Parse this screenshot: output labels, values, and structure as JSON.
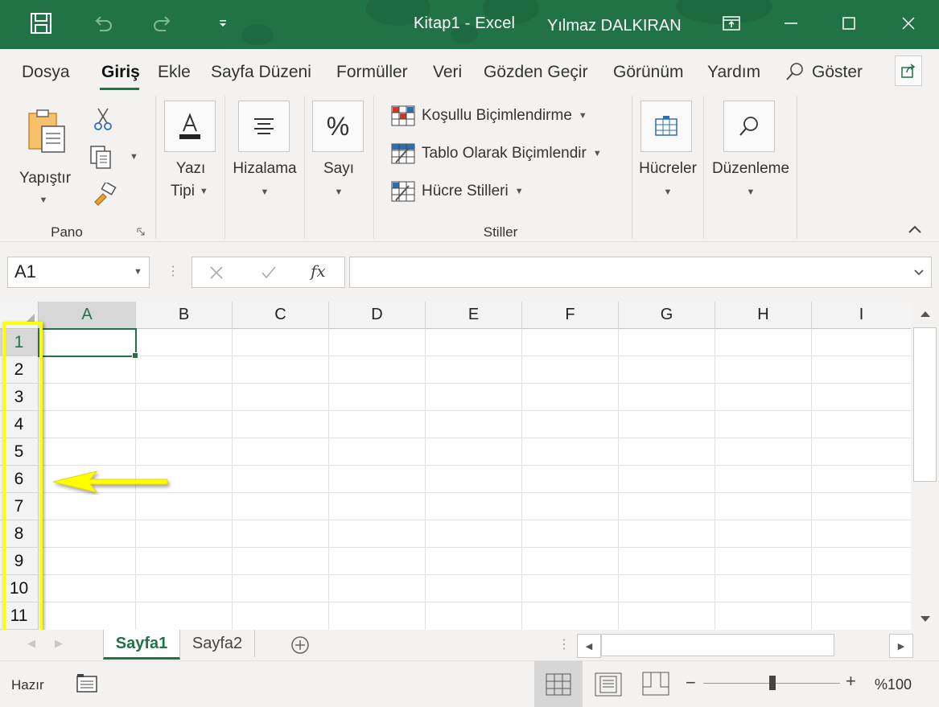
{
  "window": {
    "title": "Kitap1  -  Excel",
    "user": "Yılmaz DALKIRAN",
    "accent_color": "#217346"
  },
  "ribbon_tabs": [
    "Dosya",
    "Giriş",
    "Ekle",
    "Sayfa Düzeni",
    "Formüller",
    "Veri",
    "Gözden Geçir",
    "Görünüm",
    "Yardım",
    "Göster"
  ],
  "ribbon": {
    "paste_label": "Yapıştır",
    "pano_label": "Pano",
    "font_label_1": "Yazı",
    "font_label_2": "Tipi",
    "align_label": "Hizalama",
    "number_label": "Sayı",
    "cond_format_label": "Koşullu Biçimlendirme",
    "table_format_label": "Tablo Olarak Biçimlendir",
    "cell_styles_label": "Hücre Stilleri",
    "styles_group_label": "Stiller",
    "cells_label": "Hücreler",
    "editing_label": "Düzenleme"
  },
  "formula_bar": {
    "name_box": "A1",
    "fx": "fx",
    "formula_value": ""
  },
  "grid": {
    "columns": [
      "A",
      "B",
      "C",
      "D",
      "E",
      "F",
      "G",
      "H",
      "I"
    ],
    "rows": [
      "1",
      "2",
      "3",
      "4",
      "5",
      "6",
      "7",
      "8",
      "9",
      "10",
      "11"
    ],
    "active_cell": "A1",
    "highlight_color": "#ffff00"
  },
  "sheets": [
    "Sayfa1",
    "Sayfa2"
  ],
  "status": {
    "ready": "Hazır",
    "zoom": "%100"
  }
}
